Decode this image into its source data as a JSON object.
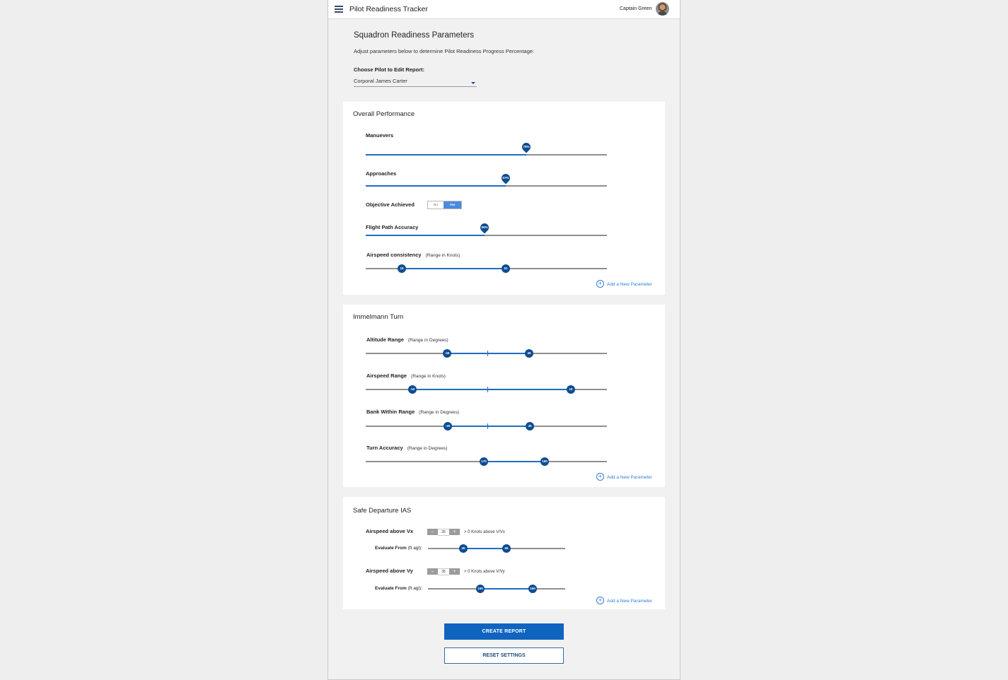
{
  "app": {
    "title": "Pilot Readiness Tracker",
    "user_name": "Captain Green"
  },
  "header": {
    "title": "Squadron Readiness Parameters",
    "subtitle": "Adjust  parameters below to determine Pilot Readiness Progress Percentage:",
    "pilot_label": "Choose Pilot to Edit Report:",
    "pilot_selected": "Corporal James Carter"
  },
  "overall": {
    "title": "Overall Performance",
    "maneuvers": {
      "label": "Manuevers",
      "value_label": "75%",
      "value": 0.67
    },
    "approaches": {
      "label": "Approaches",
      "value_label": "57%",
      "value": 0.58
    },
    "objective": {
      "label": "Objective Achieved",
      "no": "No",
      "yes": "Yes",
      "selected": "Yes"
    },
    "flight_path": {
      "label": "Flight Path Accuracy",
      "value_label": "50%",
      "value": 0.49
    },
    "airspeed": {
      "label": "Airspeed consistency",
      "sub": "(Range in Knots)",
      "low": "15",
      "high": "61"
    },
    "add_label": "Add a New Parameter"
  },
  "immelmann": {
    "title": "Immelmann Turn",
    "altitude": {
      "label": "Altitude Range",
      "sub": "(Range in Degrees)",
      "low": "-45",
      "high": "45"
    },
    "airspeed": {
      "label": "Airspeed Range",
      "sub": "(Range in Knots)",
      "low": "-10",
      "high": "10"
    },
    "bank": {
      "label": "Bank Within Range",
      "sub": "(Range in Degrees)",
      "low": "-45",
      "high": "45"
    },
    "turn": {
      "label": "Turn Accuracy",
      "sub": "(Range in Degrees)",
      "low": "170",
      "high": "190"
    },
    "add_label": "Add a New Parameter"
  },
  "departure": {
    "title": "Safe Departure IAS",
    "vx": {
      "label": "Airspeed above Vx",
      "minus": "–",
      "value": "26",
      "plus": "+",
      "note": "> 0 Knots above V/Vx",
      "eval_label": "Evaluate From",
      "eval_sub": "(ft agl):",
      "low": "30",
      "high": "65"
    },
    "vy": {
      "label": "Airspeed above Vy",
      "minus": "–",
      "value": "35",
      "plus": "+",
      "note": "> 0 Knots above V/Vy",
      "eval_label": "Evaluate From",
      "eval_sub": "(ft agl):",
      "low": "100",
      "high": "150"
    },
    "add_label": "Add a New Parameter"
  },
  "actions": {
    "create": "CREATE REPORT",
    "reset": "RESET SETTINGS"
  },
  "colors": {
    "accent": "#1f6dc2",
    "knob": "#0e4c92",
    "primary_button": "#0f64c0",
    "toggle_on": "#4a8ae0",
    "link": "#2f7ed8"
  }
}
